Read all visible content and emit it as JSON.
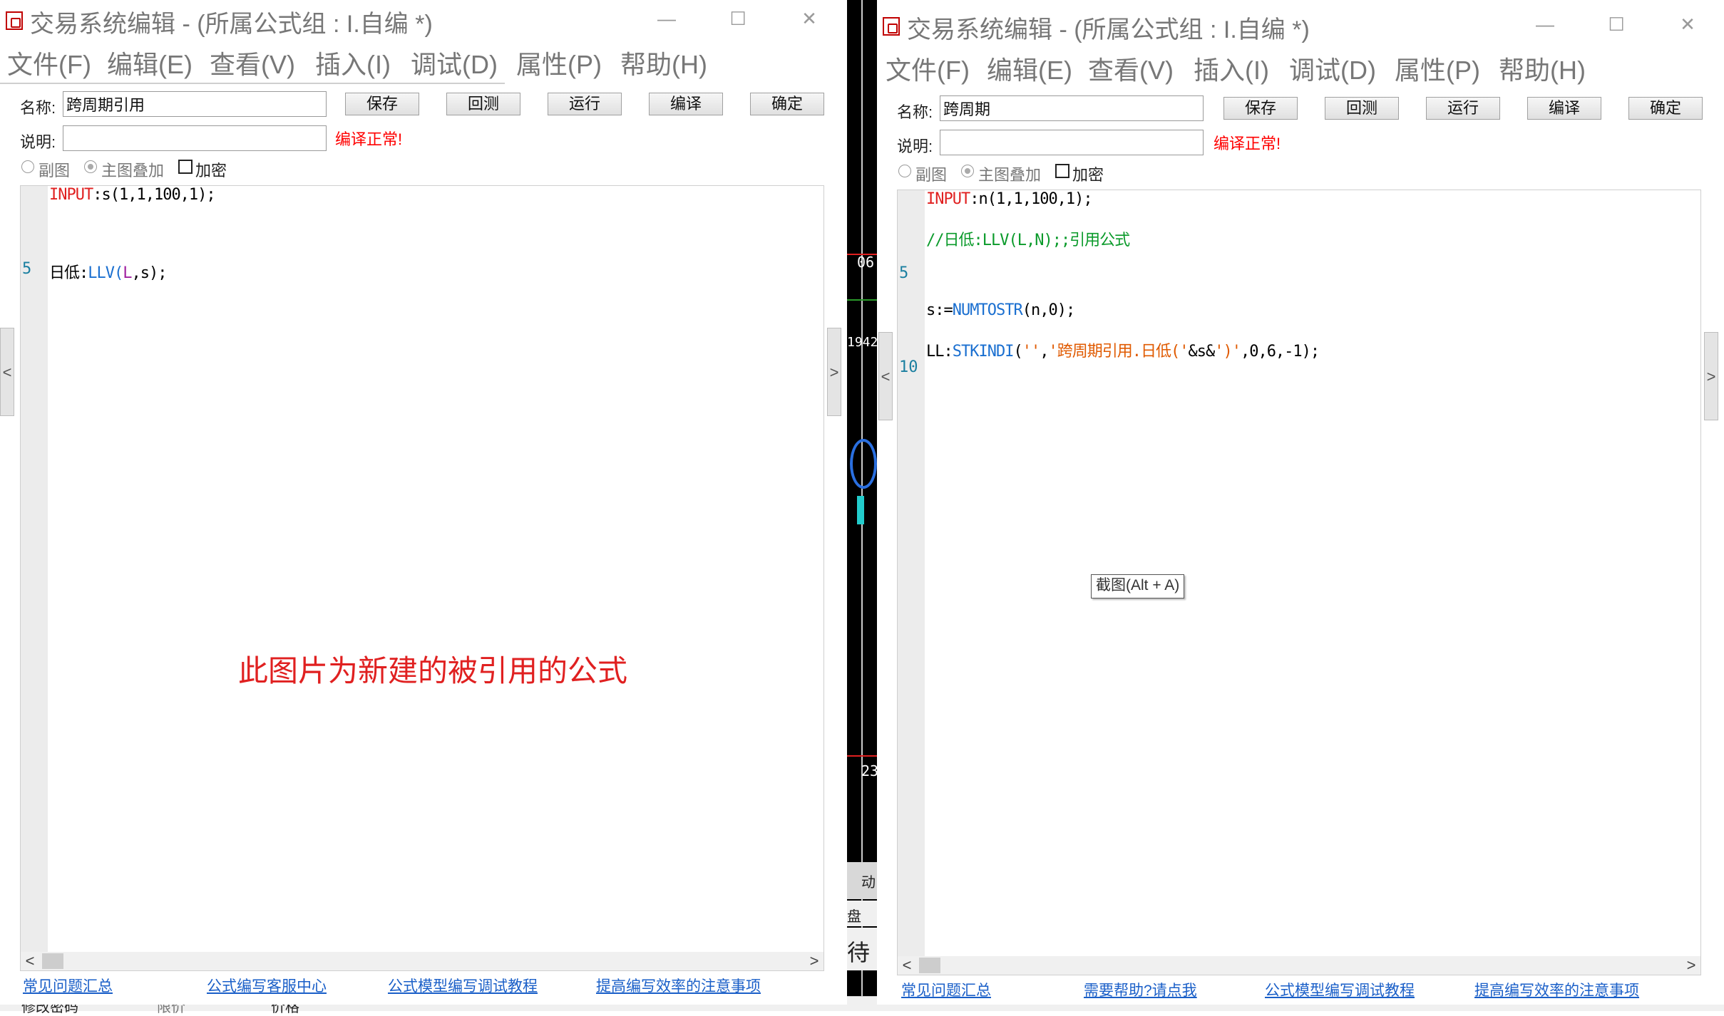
{
  "windows": {
    "left": {
      "title": "交易系统编辑 - (所属公式组 : I.自编 *)",
      "menu": [
        "文件(F)",
        "编辑(E)",
        "查看(V)",
        "插入(I)",
        "调试(D)",
        "属性(P)",
        "帮助(H)"
      ],
      "name_label": "名称:",
      "name_value": "跨周期引用",
      "desc_label": "说明:",
      "desc_value": "",
      "buttons": [
        "保存",
        "回测",
        "运行",
        "编译",
        "确定"
      ],
      "status": "编译正常!",
      "options": {
        "sub_chart": "副图",
        "main_overlay": "主图叠加",
        "encrypt": "加密"
      },
      "code": {
        "line1": {
          "kw": "INPUT",
          "rest": ":s(1,1,100,1);"
        },
        "line2": {
          "prefix": "日低:",
          "fn": "LLV",
          "open": "(",
          "arg1": "L",
          "rest": ",s);"
        }
      },
      "line_numbers": [
        "5"
      ],
      "annotation": "此图片为新建的被引用的公式",
      "footer_links": [
        "常见问题汇总",
        "公式编写客服中心",
        "公式模型编写调试教程",
        "提高编写效率的注意事项"
      ]
    },
    "right": {
      "title": "交易系统编辑 - (所属公式组 : I.自编 *)",
      "menu": [
        "文件(F)",
        "编辑(E)",
        "查看(V)",
        "插入(I)",
        "调试(D)",
        "属性(P)",
        "帮助(H)"
      ],
      "name_label": "名称:",
      "name_value": "跨周期",
      "desc_label": "说明:",
      "desc_value": "",
      "buttons": [
        "保存",
        "回测",
        "运行",
        "编译",
        "确定"
      ],
      "status": "编译正常!",
      "options": {
        "sub_chart": "副图",
        "main_overlay": "主图叠加",
        "encrypt": "加密"
      },
      "code": {
        "line1": {
          "kw": "INPUT",
          "rest": ":n(1,1,100,1);"
        },
        "comment": "//日低:LLV(L,N);;引用公式",
        "line3": {
          "prefix": "s:=",
          "fn": "NUMTOSTR",
          "rest": "(n,0);"
        },
        "line4": {
          "prefix": "LL:",
          "fn": "STKINDI",
          "p1": "(",
          "s1": "''",
          "comma": ",",
          "s2": "'跨周期引用.日低('",
          "amp": "&s&",
          "s3": "')'",
          "rest": ",0,6,-1);"
        }
      },
      "line_numbers": [
        "5",
        "10"
      ],
      "footer_links": [
        "常见问题汇总",
        "需要帮助?请点我",
        "公式模型编写调试教程",
        "提高编写效率的注意事项"
      ],
      "tooltip": "截图(Alt + A)"
    }
  },
  "window_controls": {
    "minimize": "—",
    "maximize": "☐",
    "close": "✕"
  },
  "scroll_arrows": {
    "left": "<",
    "right": ">"
  },
  "background_app": {
    "labels": [
      "06",
      "1942",
      "23",
      "动",
      "盘",
      "待"
    ],
    "bottom_texts": [
      "修改密码",
      "价格",
      "限价"
    ]
  },
  "colors": {
    "status": "#ff0000",
    "keyword": "#e02020",
    "function": "#1a6fd0",
    "comment": "#0a9a2a",
    "string": "#e05a00",
    "link": "#1a5fc8"
  }
}
